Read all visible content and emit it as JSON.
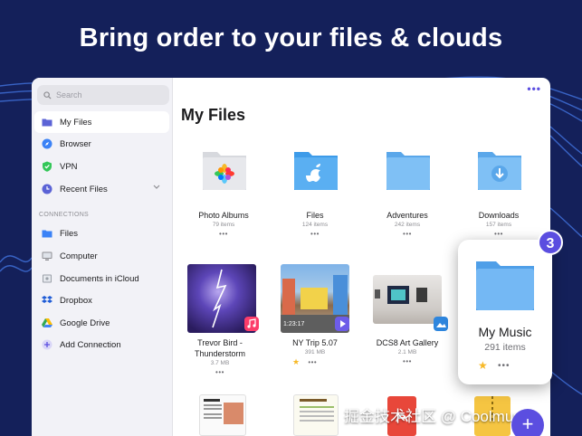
{
  "headline": "Bring order to your files & clouds",
  "search": {
    "placeholder": "Search"
  },
  "sidebar": {
    "items": [
      {
        "label": "My Files",
        "icon": "folder-icon",
        "active": true
      },
      {
        "label": "Browser",
        "icon": "compass-icon"
      },
      {
        "label": "VPN",
        "icon": "shield-icon"
      },
      {
        "label": "Recent Files",
        "icon": "clock-icon"
      }
    ],
    "section_label": "CONNECTIONS",
    "connections": [
      {
        "label": "Files",
        "icon": "folder-icon"
      },
      {
        "label": "Computer",
        "icon": "computer-icon"
      },
      {
        "label": "Documents in iCloud",
        "icon": "document-icon"
      },
      {
        "label": "Dropbox",
        "icon": "dropbox-icon"
      },
      {
        "label": "Google Drive",
        "icon": "google-drive-icon"
      },
      {
        "label": "Add Connection",
        "icon": "plus-icon"
      }
    ]
  },
  "main": {
    "title": "My Files",
    "more_label": "•••",
    "folders": [
      {
        "name": "Photo Albums",
        "meta": "79 items",
        "dots": "•••"
      },
      {
        "name": "Files",
        "meta": "124 items",
        "dots": "•••"
      },
      {
        "name": "Adventures",
        "meta": "242 items",
        "dots": "•••"
      },
      {
        "name": "Downloads",
        "meta": "157 items",
        "dots": "•••"
      }
    ],
    "media": [
      {
        "name_line1": "Trevor Bird -",
        "name_line2": "Thunderstorm",
        "meta": "3.7 MB",
        "dots": "•••"
      },
      {
        "name_line1": "NY Trip 5.07",
        "meta": "391 MB",
        "dots": "•••",
        "duration": "1:23:17",
        "star": "★"
      },
      {
        "name_line1": "DCS8 Art Gallery",
        "meta": "2.1 MB",
        "dots": "•••"
      }
    ]
  },
  "popout": {
    "name": "My Music",
    "meta": "291 items",
    "star": "★",
    "dots": "•••",
    "count": "3"
  },
  "fab_label": "+",
  "watermark": "掘金技术社区 @ Coolmuster",
  "colors": {
    "accent": "#5b4ee0",
    "background": "#14205a",
    "folder": "#6db3f2"
  }
}
